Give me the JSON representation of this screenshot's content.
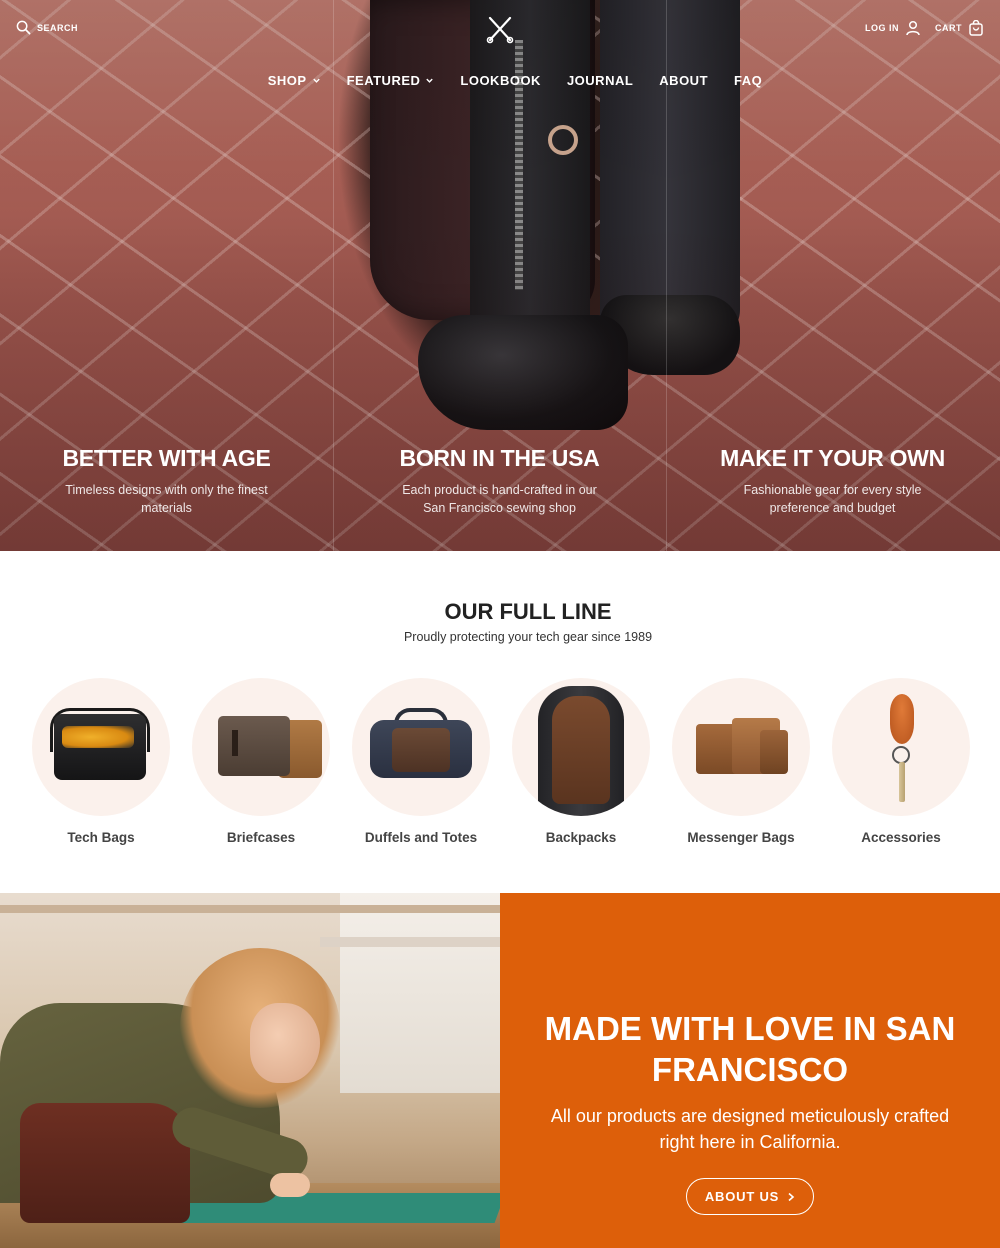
{
  "header": {
    "search_label": "SEARCH",
    "login_label": "LOG IN",
    "cart_label": "CART",
    "logo_icon": "crossed-needles-icon"
  },
  "nav": {
    "items": [
      {
        "label": "SHOP",
        "has_dropdown": true
      },
      {
        "label": "FEATURED",
        "has_dropdown": true
      },
      {
        "label": "LOOKBOOK",
        "has_dropdown": false
      },
      {
        "label": "JOURNAL",
        "has_dropdown": false
      },
      {
        "label": "ABOUT",
        "has_dropdown": false
      },
      {
        "label": "FAQ",
        "has_dropdown": false
      }
    ]
  },
  "hero": {
    "pillars": [
      {
        "title": "BETTER WITH AGE",
        "text": "Timeless designs with only the finest materials"
      },
      {
        "title": "BORN IN THE USA",
        "text": "Each product is hand-crafted in our San Francisco sewing shop"
      },
      {
        "title": "MAKE IT YOUR OWN",
        "text": "Fashionable gear for every style preference and budget"
      }
    ]
  },
  "full_line": {
    "title": "OUR FULL LINE",
    "subtitle": "Proudly protecting your tech gear since 1989",
    "categories": [
      {
        "label": "Tech Bags"
      },
      {
        "label": "Briefcases"
      },
      {
        "label": "Duffels and Totes"
      },
      {
        "label": "Backpacks"
      },
      {
        "label": "Messenger Bags"
      },
      {
        "label": "Accessories"
      }
    ]
  },
  "about": {
    "title": "MADE WITH LOVE IN SAN FRANCISCO",
    "text": "All our products are designed meticulously crafted right here in California.",
    "button_label": "ABOUT US"
  },
  "colors": {
    "accent": "#dd5f0a",
    "category_circle": "#fbf1ec"
  }
}
